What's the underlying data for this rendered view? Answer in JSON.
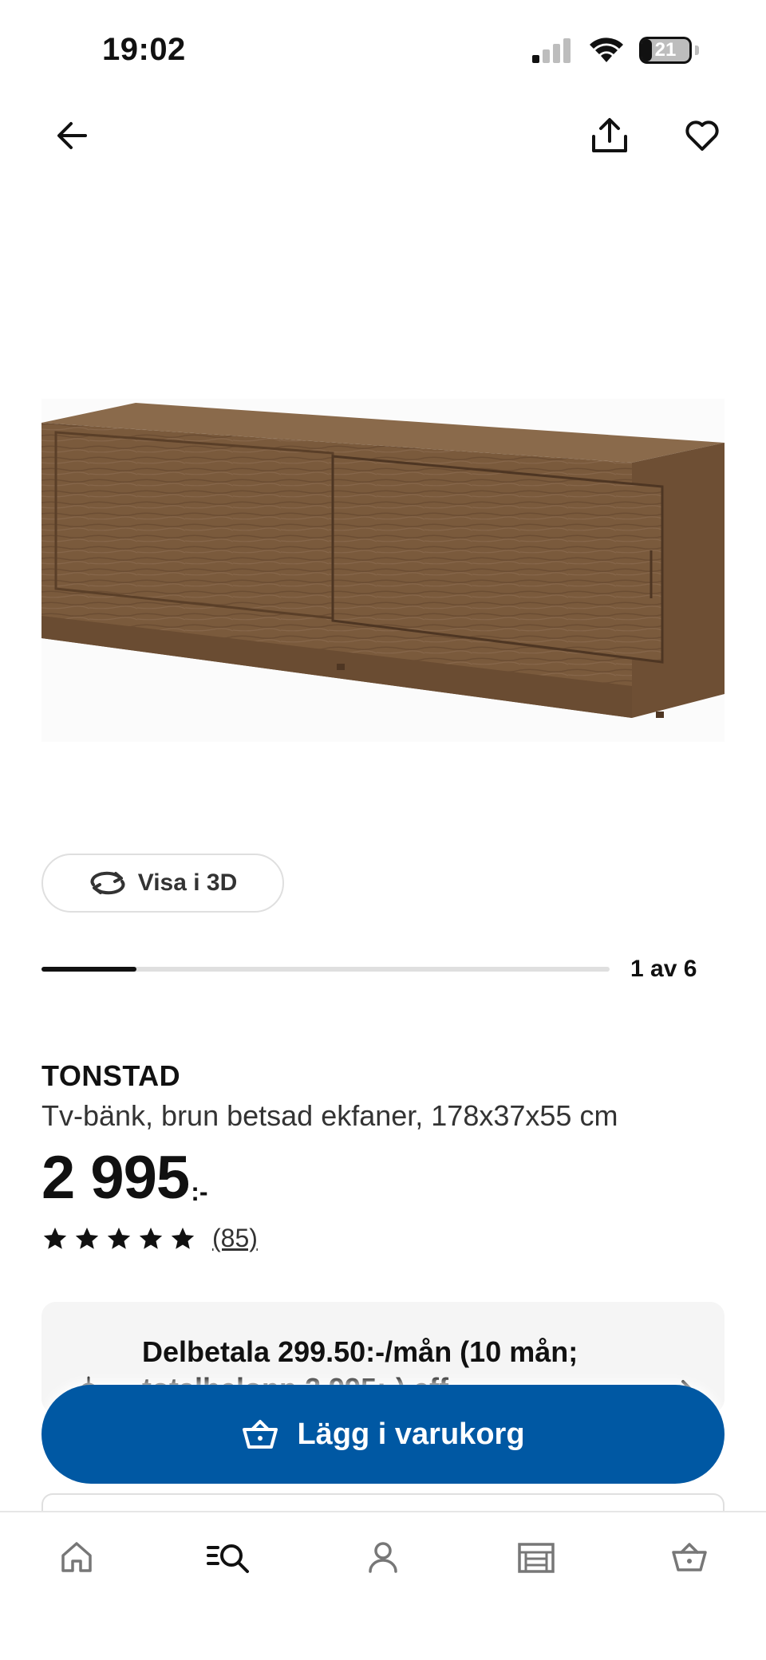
{
  "status_bar": {
    "time": "19:02",
    "battery": "21",
    "battery_level": 0.21,
    "icons": [
      "signal-icon",
      "wifi-icon",
      "battery-icon"
    ]
  },
  "top_nav": {
    "icons": [
      "back-arrow-icon",
      "share-icon",
      "heart-icon"
    ]
  },
  "gallery": {
    "view_3d_label": "Visa i 3D",
    "counter": "1 av 6",
    "current": 1,
    "total": 6
  },
  "product": {
    "name": "TONSTAD",
    "description": "Tv-bänk, brun betsad ekfaner, 178x37x55 cm",
    "price": "2 995",
    "price_suffix": ":-",
    "rating": 5,
    "rating_max": 5,
    "review_count": "(85)"
  },
  "installment": {
    "text": "Delbetala 299.50:-/mån (10 mån; totalbelopp 2 995:-) eff."
  },
  "cart_button": {
    "label": "Lägg i varukorg"
  },
  "bottom_nav": {
    "items": [
      "home-icon",
      "search-icon",
      "profile-icon",
      "store-icon",
      "cart-icon"
    ]
  },
  "colors": {
    "primary": "#0058a3",
    "wood": "#7a5a3c",
    "text": "#111111"
  }
}
